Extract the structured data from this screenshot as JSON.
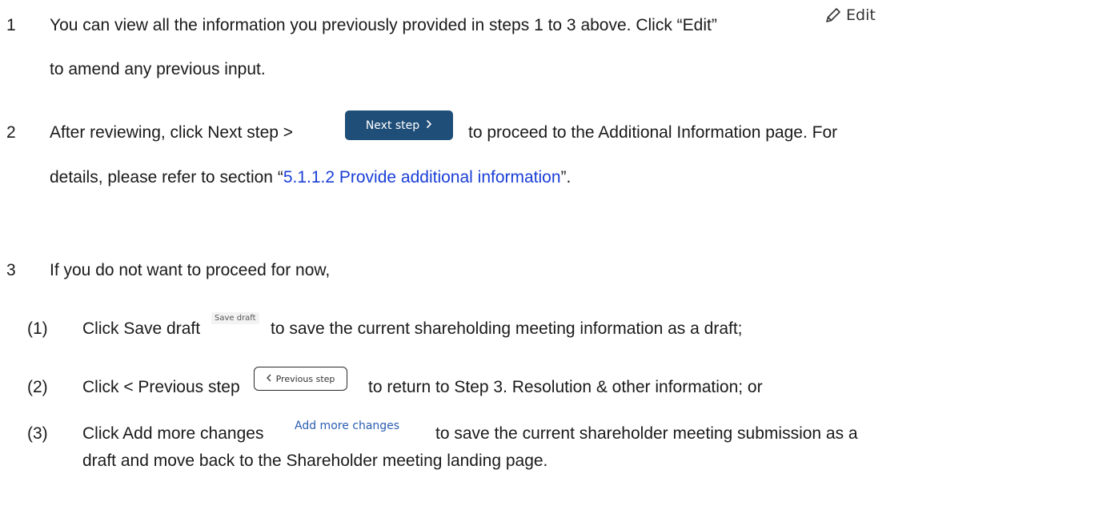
{
  "steps": [
    {
      "number": "1",
      "line1": "You can view all the information you previously provided in steps 1 to 3 above. Click “Edit”",
      "line2": "to amend any previous input.",
      "edit_widget": {
        "label": "Edit",
        "icon": "pencil-icon"
      }
    },
    {
      "number": "2",
      "line1_before": "After reviewing, click Next step >",
      "line1_after": "to proceed to the Additional Information page. For",
      "line2_before": "details, please refer to section “",
      "link_text": "5.1.1.2 Provide additional information",
      "line2_after": "”.",
      "next_button": {
        "label": "Next step",
        "icon": "chevron-right-icon"
      }
    },
    {
      "number": "3",
      "intro": "If you do not want to proceed for now,",
      "substeps": [
        {
          "marker": "(1)",
          "before": "Click Save draft",
          "widget_label": "Save draft",
          "after": "to save the current shareholding meeting information as a draft;"
        },
        {
          "marker": "(2)",
          "before": "Click < Previous step",
          "widget_label": "Previous step",
          "widget_icon": "chevron-left-icon",
          "after": "to return to Step 3. Resolution & other information; or"
        },
        {
          "marker": "(3)",
          "before": "Click Add more changes",
          "widget_label": "Add more changes",
          "after": "to save the current shareholder meeting submission as a",
          "line2": "draft and move back to the Shareholder meeting landing page."
        }
      ]
    }
  ],
  "colors": {
    "text": "#1a1a1a",
    "link": "#1a3fd6",
    "next_button_bg": "#1f4e79",
    "add_changes_text": "#2a5db0"
  }
}
